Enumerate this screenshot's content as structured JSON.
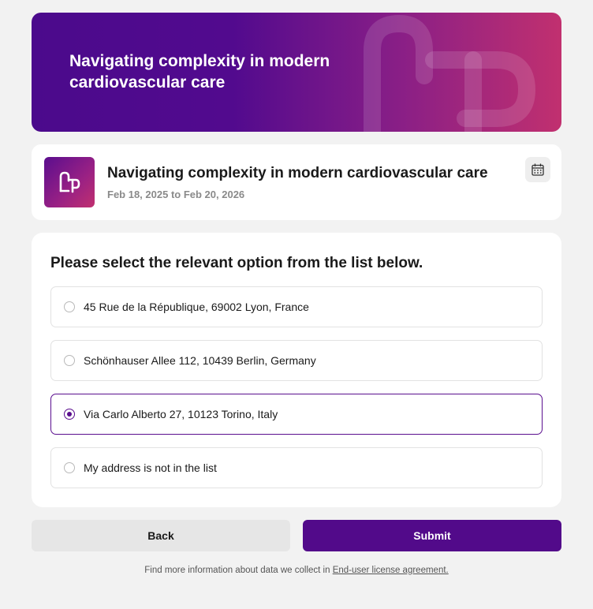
{
  "hero": {
    "title": "Navigating complexity in modern cardiovascular care"
  },
  "event": {
    "title": "Navigating complexity in modern cardiovascular care",
    "dates": "Feb 18, 2025 to Feb 20, 2026"
  },
  "form": {
    "question": "Please select the relevant option from the list below.",
    "options": [
      {
        "label": "45 Rue de la République, 69002 Lyon, France",
        "selected": false
      },
      {
        "label": "Schönhauser Allee 112, 10439 Berlin, Germany",
        "selected": false
      },
      {
        "label": "Via Carlo Alberto 27, 10123 Torino, Italy",
        "selected": true
      },
      {
        "label": "My address is not in the list",
        "selected": false
      }
    ]
  },
  "actions": {
    "back_label": "Back",
    "submit_label": "Submit"
  },
  "footer": {
    "text": "Find more information about data we collect in",
    "link_label": "End-user license agreement."
  },
  "colors": {
    "brand_primary": "#520a8a",
    "brand_accent": "#c1306f"
  }
}
